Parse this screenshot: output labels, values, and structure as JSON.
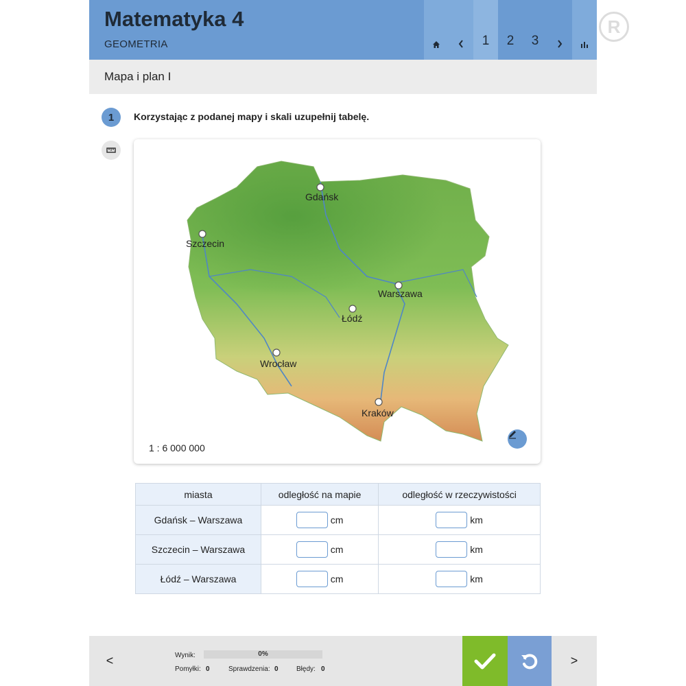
{
  "header": {
    "title": "Matematyka 4",
    "subtitle": "GEOMETRIA",
    "nav": [
      {
        "name": "home-button",
        "label": "⌂"
      },
      {
        "name": "prev-page-button",
        "label": "‹"
      },
      {
        "name": "page-1-button",
        "label": "1"
      },
      {
        "name": "page-2-button",
        "label": "2"
      },
      {
        "name": "page-3-button",
        "label": "3"
      },
      {
        "name": "next-page-button",
        "label": "›"
      },
      {
        "name": "stats-button",
        "label": "ılı"
      }
    ]
  },
  "lesson": {
    "title": "Mapa i plan I"
  },
  "task": {
    "number": "1",
    "instruction": "Korzystając z podanej mapy i skali uzupełnij tabelę.",
    "map": {
      "scale": "1 : 6 000 000",
      "cities": [
        "Gdańsk",
        "Szczecin",
        "Warszawa",
        "Łódź",
        "Wrocław",
        "Kraków"
      ]
    }
  },
  "table": {
    "headers": [
      "miasta",
      "odległość na mapie",
      "odległość w rzeczywistości"
    ],
    "rows": [
      {
        "pair": "Gdańsk – Warszawa",
        "map_unit": "cm",
        "real_unit": "km"
      },
      {
        "pair": "Szczecin – Warszawa",
        "map_unit": "cm",
        "real_unit": "km"
      },
      {
        "pair": "Łódź – Warszawa",
        "map_unit": "cm",
        "real_unit": "km"
      }
    ]
  },
  "footer": {
    "prev": "<",
    "next": ">",
    "score_label": "Wynik:",
    "score_value": "0%",
    "mistakes_label": "Pomyłki:",
    "mistakes": "0",
    "checks_label": "Sprawdzenia:",
    "checks": "0",
    "errors_label": "Błędy:",
    "errors": "0"
  },
  "colors": {
    "accent": "#6b9bd2",
    "check": "#7fbb2a",
    "reset": "#7a9fd4"
  },
  "watermark": {
    "brand_mark": "R"
  }
}
